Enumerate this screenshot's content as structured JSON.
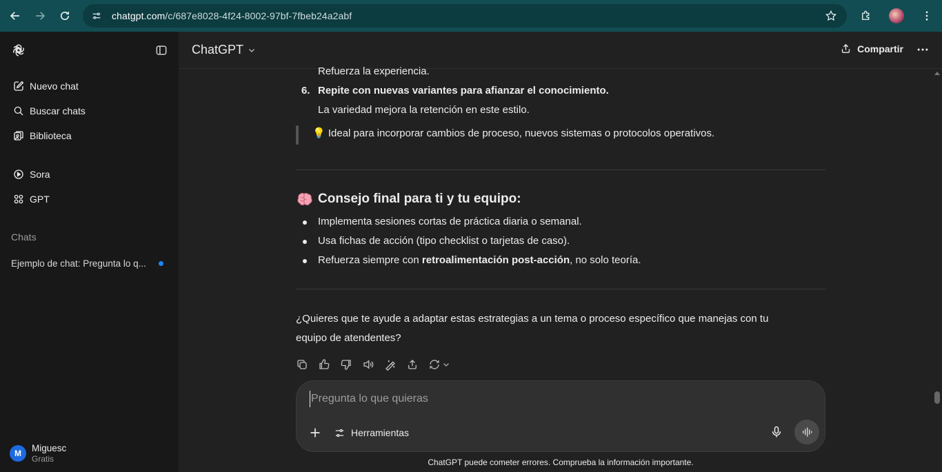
{
  "browser": {
    "url_host": "chatgpt.com",
    "url_path": "/c/687e8028-4f24-8002-97bf-7fbeb24a2abf"
  },
  "sidebar": {
    "items": [
      {
        "label": "Nuevo chat",
        "icon": "edit-icon"
      },
      {
        "label": "Buscar chats",
        "icon": "search-icon"
      },
      {
        "label": "Biblioteca",
        "icon": "library-icon"
      },
      {
        "label": "Sora",
        "icon": "play-circle-icon"
      },
      {
        "label": "GPT",
        "icon": "grid-icon"
      }
    ],
    "section_label": "Chats",
    "chats": [
      {
        "title": "Ejemplo de chat: Pregunta lo q..."
      }
    ],
    "user": {
      "initial": "M",
      "name": "Miguesc",
      "plan": "Gratis"
    }
  },
  "header": {
    "model": "ChatGPT",
    "share_label": "Compartir"
  },
  "message": {
    "step5_sub": "Refuerza la experiencia.",
    "step6_num": "6.",
    "step6_title": "Repite con nuevas variantes para afianzar el conocimiento.",
    "step6_sub": "La variedad mejora la retención en este estilo.",
    "tip_emoji": "💡",
    "tip": "Ideal para incorporar cambios de proceso, nuevos sistemas o protocolos operativos.",
    "heading": "Consejo final para ti y tu equipo:",
    "bullets": [
      {
        "text": "Implementa sesiones cortas de práctica diaria o semanal."
      },
      {
        "text": "Usa fichas de acción (tipo checklist o tarjetas de caso)."
      },
      {
        "pre": "Refuerza siempre con ",
        "bold": "retroalimentación post-acción",
        "post": ", no solo teoría."
      }
    ],
    "question_line1": "¿Quieres que te ayude a adaptar estas estrategias a un tema o proceso específico que manejas con tu",
    "question_line2": "equipo de atendentes?"
  },
  "composer": {
    "placeholder": "Pregunta lo que quieras",
    "tools_label": "Herramientas"
  },
  "disclaimer": "ChatGPT puede cometer errores. Comprueba la información importante."
}
